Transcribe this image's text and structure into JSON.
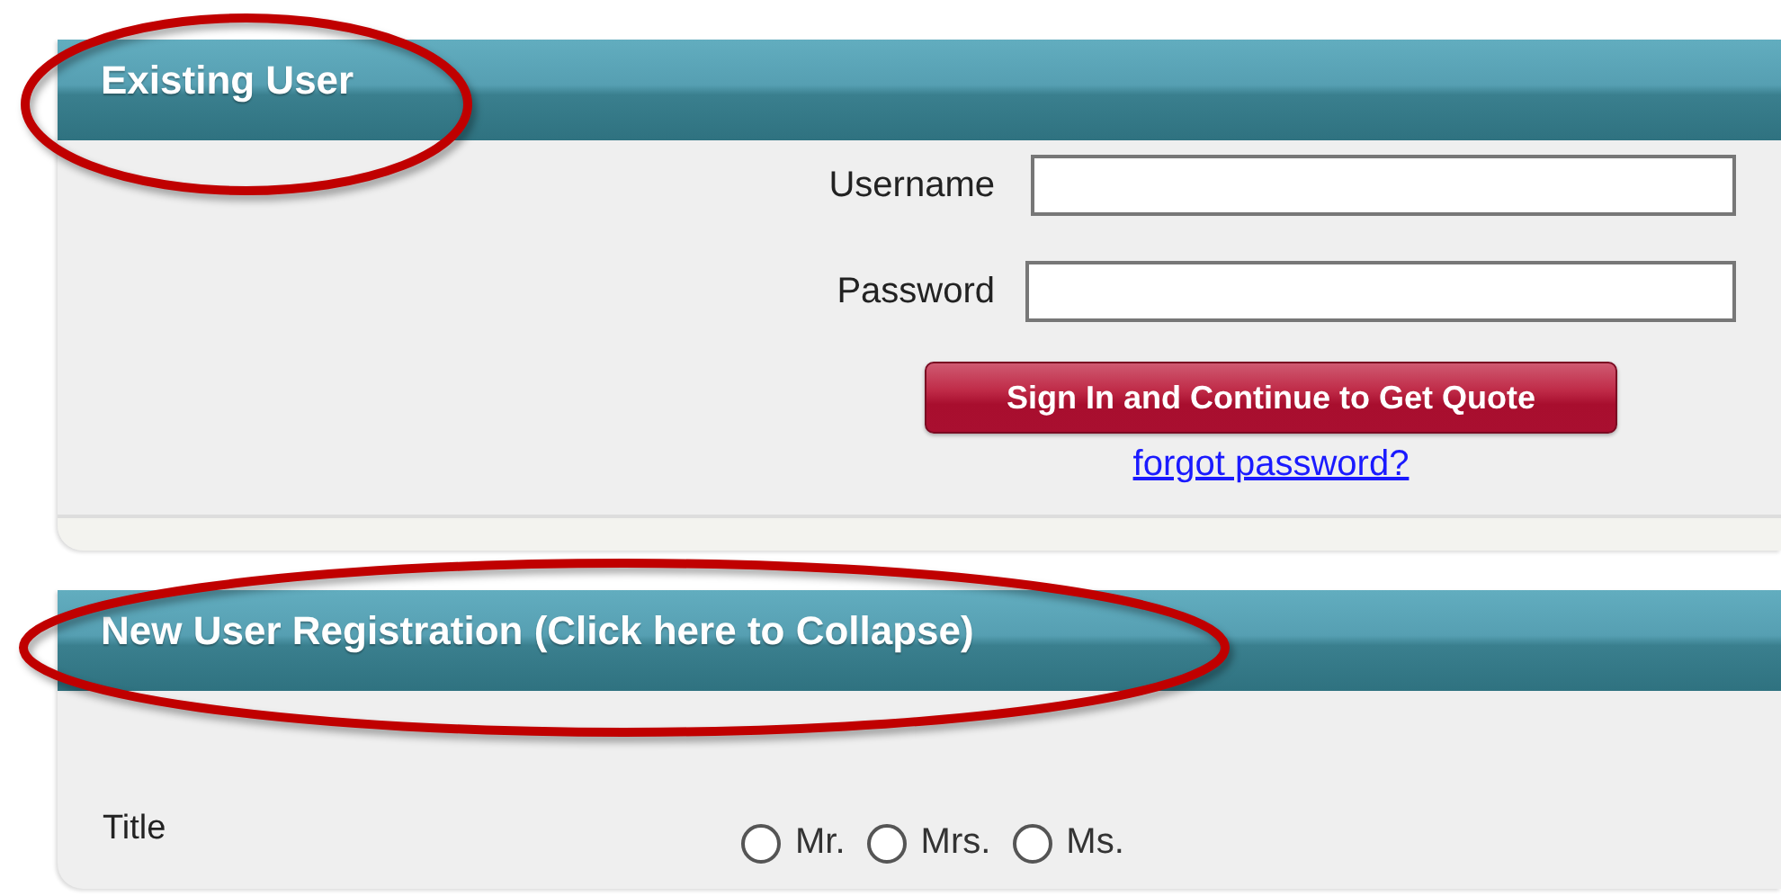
{
  "sections": [
    {
      "kind": "login",
      "title": "Existing User",
      "annotated": true,
      "fields": [
        {
          "label": "Username"
        },
        {
          "label": "Password"
        }
      ],
      "button": "Sign In and Continue to Get Quote",
      "link": "forgot password?"
    },
    {
      "kind": "registration",
      "title": "New User Registration (Click here to Collapse)",
      "annotated": true,
      "title_field": {
        "label": "Title",
        "options": [
          {
            "label": "Mr.",
            "selected": false
          },
          {
            "label": "Mrs.",
            "selected": false
          },
          {
            "label": "Ms.",
            "selected": false
          }
        ]
      }
    }
  ]
}
